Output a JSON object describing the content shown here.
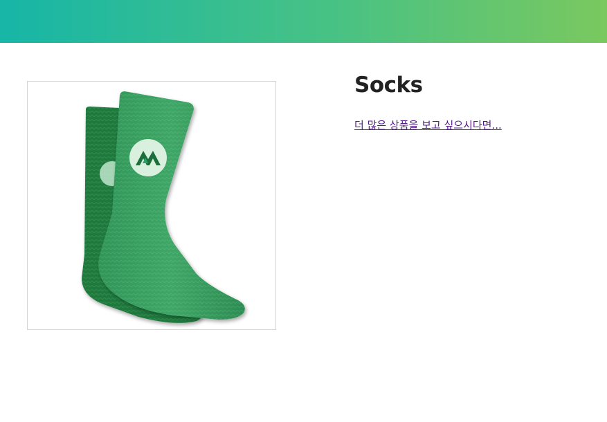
{
  "product": {
    "title": "Socks",
    "image_alt": "Socks"
  },
  "links": {
    "more_products": "더 많은 상품을 보고 싶으시다면..."
  },
  "colors": {
    "header_gradient_start": "#17b6a7",
    "header_gradient_end": "#7ac85f",
    "sock_front": "#3a9f61",
    "sock_back": "#1f7a3c",
    "link_visited": "#551a8b",
    "title_text": "#222222"
  },
  "icons": {
    "sock_logo": "mountain-logo-icon"
  }
}
